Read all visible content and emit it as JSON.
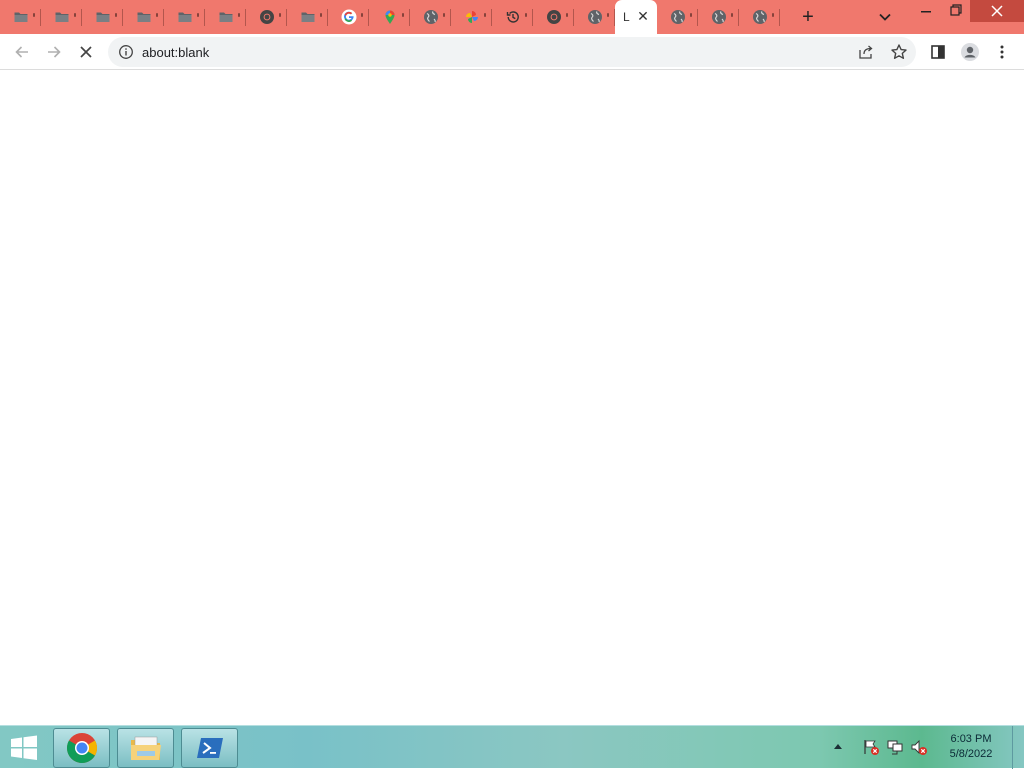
{
  "browser": {
    "tabs": [
      {
        "icon": "folder-icon"
      },
      {
        "icon": "folder-icon"
      },
      {
        "icon": "folder-icon"
      },
      {
        "icon": "folder-icon"
      },
      {
        "icon": "folder-icon"
      },
      {
        "icon": "folder-icon"
      },
      {
        "icon": "chrome-icon"
      },
      {
        "icon": "folder-icon"
      },
      {
        "icon": "google-icon"
      },
      {
        "icon": "maps-pin-icon"
      },
      {
        "icon": "globe-icon"
      },
      {
        "icon": "photos-pinwheel-icon"
      },
      {
        "icon": "history-icon"
      },
      {
        "icon": "chrome-icon"
      },
      {
        "icon": "globe-icon"
      },
      {
        "icon": "none",
        "active": true,
        "label": "L",
        "close_glyph": "✕"
      },
      {
        "icon": "globe-icon"
      },
      {
        "icon": "globe-icon"
      },
      {
        "icon": "globe-icon"
      }
    ],
    "new_tab_glyph": "+",
    "tab_strip_color": "#f0786d",
    "omnibox": {
      "url": "about:blank"
    }
  },
  "taskbar": {
    "apps": [
      {
        "name": "chrome",
        "icon": "chrome-icon"
      },
      {
        "name": "file-explorer",
        "icon": "folder-icon"
      },
      {
        "name": "powershell",
        "icon": "powershell-icon"
      }
    ],
    "tray": {
      "time": "6:03 PM",
      "date": "5/8/2022"
    }
  }
}
